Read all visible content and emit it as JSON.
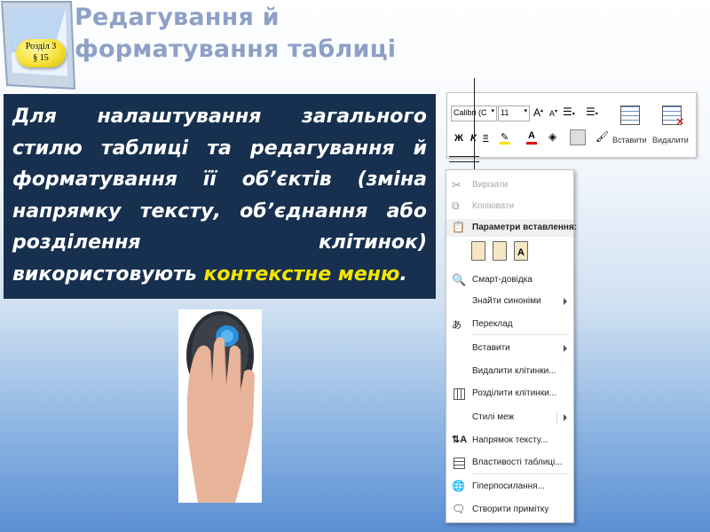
{
  "slide": {
    "title": "Редагування й форматування таблиці",
    "badge_line1": "Розділ 3",
    "badge_line2": "§ 15",
    "body_lines": [
      "Для налаштування загального",
      "стилю таблиці та редагування й",
      "форматування її об’єктів  (зміна",
      "напрямку тексту, об’єднання або",
      "розділення                   клітинок)",
      "використовують "
    ],
    "body_highlight": "контекстне меню",
    "body_end": "."
  },
  "ribbon": {
    "font_name": "Calibri (C",
    "font_size": "11",
    "insert_label": "Вставити",
    "delete_label": "Видалити",
    "bold_label": "Ж",
    "italic_label": "К"
  },
  "context_menu": {
    "cut": "Вирізати",
    "copy": "Копіювати",
    "paste_options": "Параметри вставлення:",
    "smart_lookup": "Смарт-довідка",
    "synonyms": "Знайти синоніми",
    "translate": "Переклад",
    "insert": "Вставити",
    "delete_cells": "Видалити клітинки...",
    "split_cells": "Розділити клітинки...",
    "border_styles": "Стилі меж",
    "text_direction": "Напрямок тексту...",
    "table_properties": "Властивості таблиці...",
    "hyperlink": "Гіперпосилання...",
    "new_comment": "Створити примітку"
  },
  "colors": {
    "title": "#8ea0c6",
    "textbox_bg": "#18304f",
    "highlight": "#f3e600",
    "badge": "#f6e23a"
  }
}
